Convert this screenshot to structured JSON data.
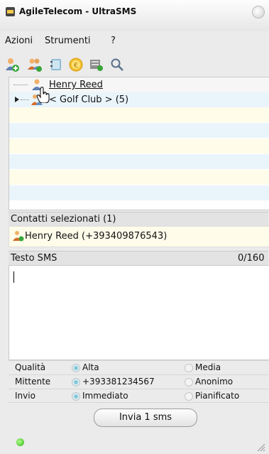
{
  "window": {
    "title": "AgileTelecom - UltraSMS"
  },
  "menu": [
    {
      "label": "Azioni"
    },
    {
      "label": "Strumenti"
    },
    {
      "label": "?"
    }
  ],
  "toolbar": {
    "icons": [
      "add-contact-icon",
      "add-group-icon",
      "address-book-icon",
      "credit-euro-icon",
      "sms-send-icon",
      "search-icon"
    ]
  },
  "contacts_tree": {
    "items": [
      {
        "label": "Henry Reed",
        "type": "contact"
      },
      {
        "label": "< Golf Club > (5)",
        "type": "group"
      }
    ]
  },
  "selected": {
    "header": "Contatti selezionati (1)",
    "items": [
      {
        "label": "Henry Reed (+393409876543)"
      }
    ]
  },
  "sms": {
    "header": "Testo SMS",
    "counter": "0/160",
    "text": ""
  },
  "options": {
    "quality": {
      "label": "Qualità",
      "opt1": "Alta",
      "opt2": "Media",
      "selected": "Alta"
    },
    "sender": {
      "label": "Mittente",
      "opt1": "+393381234567",
      "opt2": "Anonimo",
      "selected": "+393381234567"
    },
    "send": {
      "label": "Invio",
      "opt1": "Immediato",
      "opt2": "Pianificato",
      "selected": "Immediato"
    }
  },
  "send_button": {
    "label": "Invia 1 sms"
  },
  "status": {
    "indicator_color": "#39b11a"
  }
}
